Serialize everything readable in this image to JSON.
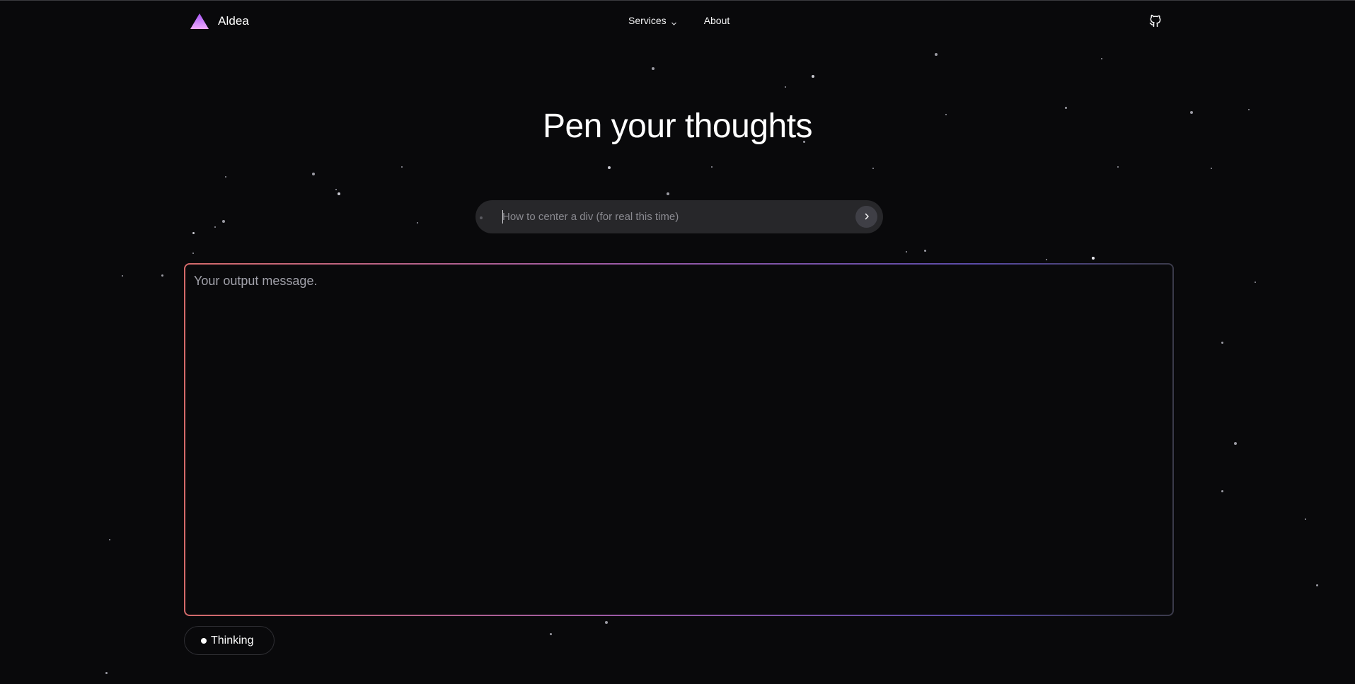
{
  "header": {
    "brand_name": "Aldea",
    "nav": {
      "services_label": "Services",
      "about_label": "About"
    },
    "github_icon": "github-icon"
  },
  "hero": {
    "title": "Pen your thoughts"
  },
  "prompt": {
    "placeholder": "How to center a div (for real this time)",
    "value": "",
    "send_icon": "chevron-right-icon"
  },
  "output": {
    "placeholder_text": "Your output message."
  },
  "status": {
    "thinking_label": "Thinking"
  },
  "colors": {
    "background": "#09090b",
    "logo_gradient_top": "#a855f7",
    "logo_gradient_bottom": "#f0abfc",
    "output_border_start": "#d46a6a",
    "output_border_end": "#5a4ba8"
  }
}
